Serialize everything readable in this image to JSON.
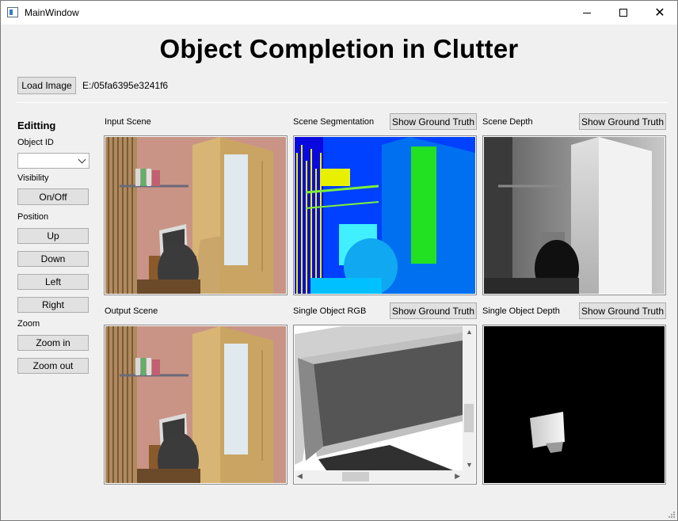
{
  "window": {
    "title": "MainWindow",
    "minimize_glyph": "",
    "maximize_glyph": "",
    "close_glyph": "✕"
  },
  "header": {
    "title": "Object Completion in Clutter",
    "load_button": "Load Image",
    "path": "E:/05fa6395e3241f6"
  },
  "sidebar": {
    "heading": "Editting",
    "object_id_label": "Object ID",
    "object_id_value": "",
    "visibility_label": "Visibility",
    "onoff_button": "On/Off",
    "position_label": "Position",
    "up_button": "Up",
    "down_button": "Down",
    "left_button": "Left",
    "right_button": "Right",
    "zoom_label": "Zoom",
    "zoom_in_button": "Zoom in",
    "zoom_out_button": "Zoom out"
  },
  "panels": {
    "input_scene": {
      "label": "Input Scene"
    },
    "scene_segmentation": {
      "label": "Scene Segmentation",
      "button": "Show Ground Truth"
    },
    "scene_depth": {
      "label": "Scene Depth",
      "button": "Show Ground Truth"
    },
    "output_scene": {
      "label": "Output Scene"
    },
    "single_object_rgb": {
      "label": "Single Object RGB",
      "button": "Show Ground Truth"
    },
    "single_object_depth": {
      "label": "Single Object Depth",
      "button": "Show Ground Truth"
    }
  },
  "colors": {
    "accent_segmentation_blue": "#0040ff",
    "segmentation_green": "#22e022",
    "segmentation_cyan": "#00e5ff",
    "segmentation_yellow": "#e8f000",
    "wall_pink": "#c99485",
    "wardrobe_wood": "#d8b574"
  }
}
